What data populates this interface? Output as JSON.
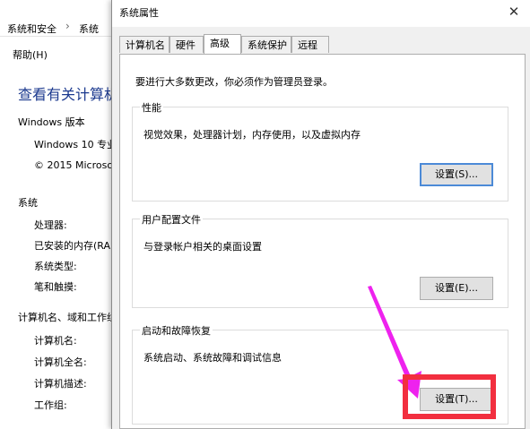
{
  "background_window": {
    "breadcrumb": [
      "系统和安全",
      "系统"
    ],
    "breadcrumb_separator": "›",
    "menu_help": "帮助(H)",
    "heading": "查看有关计算机",
    "windows_edition_section": "Windows 版本",
    "windows_edition_value": "Windows 10 专业",
    "copyright_value": "© 2015 Microso",
    "system_section": "系统",
    "system_rows": [
      "处理器:",
      "已安装的内存(RAM",
      "系统类型:",
      "笔和触摸:"
    ],
    "computer_section": "计算机名、域和工作组",
    "computer_rows": [
      "计算机名:",
      "计算机全名:",
      "计算机描述:",
      "工作组:"
    ]
  },
  "dialog": {
    "title": "系统属性",
    "close_glyph": "✕",
    "tabs": [
      {
        "label": "计算机名",
        "active": false
      },
      {
        "label": "硬件",
        "active": false
      },
      {
        "label": "高级",
        "active": true
      },
      {
        "label": "系统保护",
        "active": false
      },
      {
        "label": "远程",
        "active": false
      }
    ],
    "admin_note": "要进行大多数更改，你必须作为管理员登录。",
    "groups": [
      {
        "legend": "性能",
        "description": "视觉效果，处理器计划，内存使用，以及虚拟内存",
        "button": "设置(S)..."
      },
      {
        "legend": "用户配置文件",
        "description": "与登录帐户相关的桌面设置",
        "button": "设置(E)..."
      },
      {
        "legend": "启动和故障恢复",
        "description": "系统启动、系统故障和调试信息",
        "button": "设置(T)..."
      }
    ]
  },
  "annotation": {
    "arrow_color": "#ee22ee",
    "box_color": "#f22f3f"
  }
}
